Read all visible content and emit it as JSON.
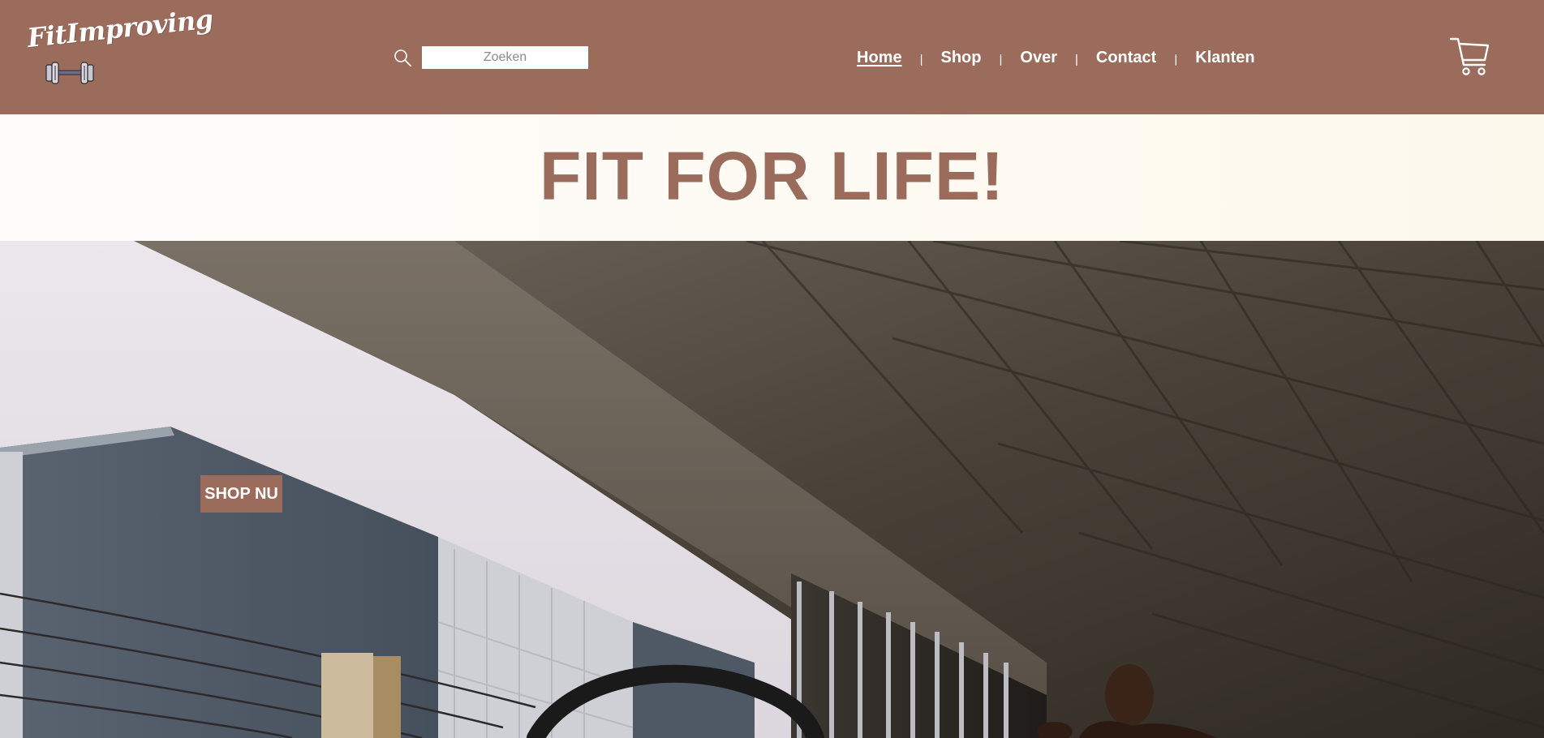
{
  "header": {
    "logo_text": "FitImproving",
    "search": {
      "placeholder": "Zoeken",
      "value": ""
    },
    "nav": [
      {
        "label": "Home",
        "active": true
      },
      {
        "label": "Shop",
        "active": false
      },
      {
        "label": "Over",
        "active": false
      },
      {
        "label": "Contact",
        "active": false
      },
      {
        "label": "Klanten",
        "active": false
      }
    ],
    "nav_separator": "|",
    "icons": {
      "search": "search-icon",
      "cart": "cart-icon",
      "logo_mark": "dumbbell-icon"
    }
  },
  "hero": {
    "tagline": "FIT FOR LIFE!",
    "cta_label": "SHOP NU",
    "image_subject": "hero-photo"
  },
  "colors": {
    "brand": "#9b6c5c",
    "header_text": "#ffffff",
    "tagline_bg": "#fefbf4"
  }
}
